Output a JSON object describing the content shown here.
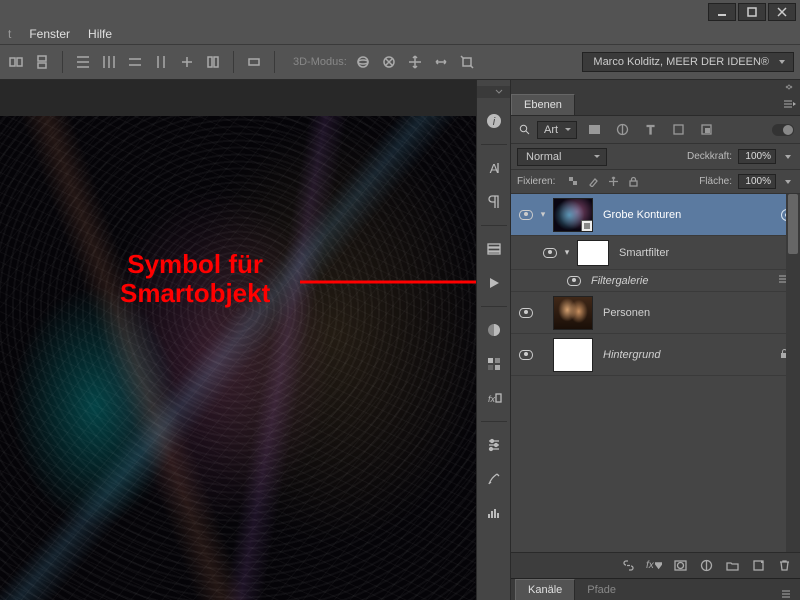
{
  "window": {
    "menu_fenster": "Fenster",
    "menu_hilfe": "Hilfe"
  },
  "options": {
    "mode3d_label": "3D-Modus:",
    "brand": "Marco Kolditz, MEER DER IDEEN®"
  },
  "annotation": {
    "line1": "Symbol für",
    "line2": "Smartobjekt"
  },
  "panels": {
    "ebenen_tab": "Ebenen",
    "filter_kind": "Art",
    "blend_mode": "Normal",
    "opacity_label": "Deckkraft:",
    "opacity_value": "100%",
    "lock_label": "Fixieren:",
    "fill_label": "Fläche:",
    "fill_value": "100%",
    "layers": {
      "l0": "Grobe Konturen",
      "l1": "Smartfilter",
      "l2": "Filtergalerie",
      "l3": "Personen",
      "l4": "Hintergrund"
    },
    "kanaele_tab": "Kanäle",
    "pfade_tab": "Pfade"
  }
}
